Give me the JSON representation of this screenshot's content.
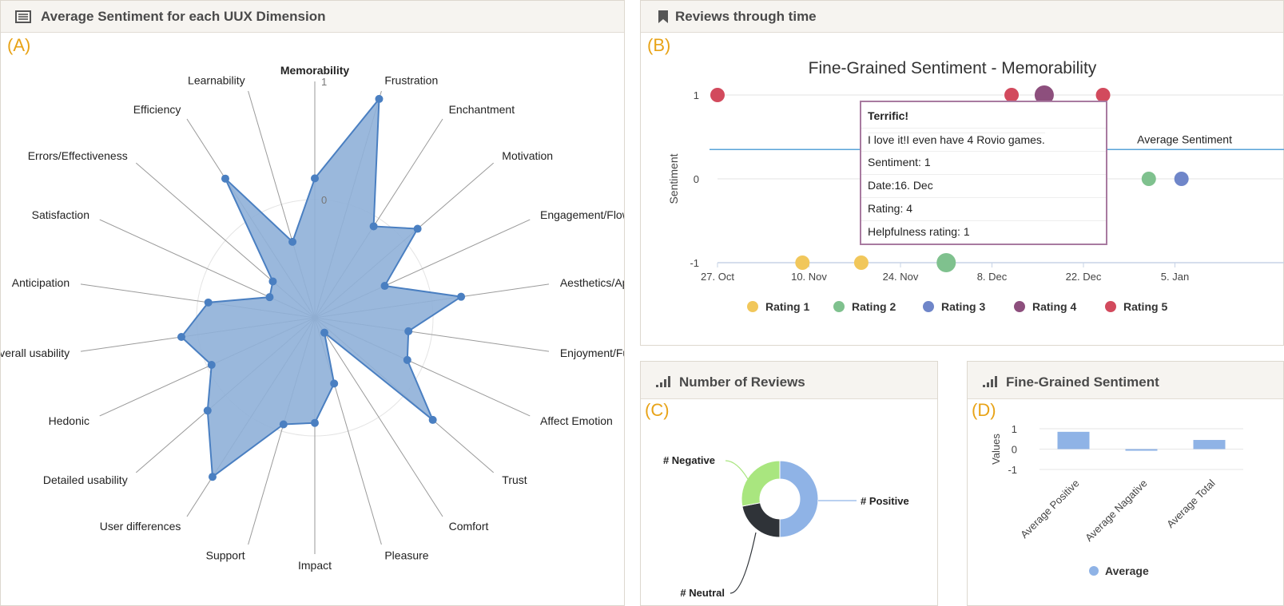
{
  "colors": {
    "accent_label": "#e8a317",
    "radar_fill": "#8fb0d8",
    "radar_line": "#4a7fc1",
    "rating1": "#f1c75b",
    "rating2": "#7fc18e",
    "rating3": "#6f86c9",
    "rating4": "#8d4f7d",
    "rating5": "#d24a5d",
    "positive": "#8fb3e6",
    "negative": "#a9e67f",
    "neutral": "#2f3338"
  },
  "panels": {
    "a": {
      "title": "Average Sentiment for each UUX Dimension",
      "label": "(A)",
      "icon": "list-icon"
    },
    "b": {
      "title": "Reviews through time",
      "label": "(B)",
      "icon": "bookmark-icon"
    },
    "c": {
      "title": "Number of Reviews",
      "label": "(C)",
      "icon": "signal-bars-icon"
    },
    "d": {
      "title": "Fine-Grained Sentiment",
      "label": "(D)",
      "icon": "signal-bars-icon"
    }
  },
  "tooltip": {
    "title": "Terrific!",
    "review": "I love it!I even have 4 Rovio games.",
    "sentiment": "Sentiment: 1",
    "date": "Date:16. Dec",
    "rating": "Rating: 4",
    "helpfulness": "Helpfulness rating: 1"
  },
  "chart_data": [
    {
      "type": "radar",
      "panel": "A",
      "categories": [
        "Memorability",
        "Frustration",
        "Enchantment",
        "Motivation",
        "Engagement/Flow",
        "Aesthetics/Appeal",
        "Enjoyment/Fun",
        "Affect Emotion",
        "Trust",
        "Comfort",
        "Pleasure",
        "Impact",
        "Support",
        "User differences",
        "Detailed usability",
        "Hedonic",
        "Overall usability",
        "Anticipation",
        "Satisfaction",
        "Errors/Effectiveness",
        "Efficiency",
        "Learnability"
      ],
      "values": [
        0.18,
        0.93,
        -0.08,
        0.15,
        -0.35,
        0.25,
        -0.2,
        -0.14,
        0.32,
        -0.85,
        -0.42,
        -0.11,
        -0.06,
        0.6,
        0.2,
        -0.04,
        0.14,
        -0.09,
        -0.58,
        -0.53,
        0.4,
        -0.33
      ],
      "value_label_memorability": "Memorability",
      "tick_labels": [
        "1",
        "0"
      ],
      "rlim": [
        -1,
        1
      ]
    },
    {
      "type": "scatter",
      "panel": "B",
      "title": "Fine-Grained Sentiment - Memorability",
      "ylabel": "Sentiment",
      "x_ticks": [
        "27. Oct",
        "10. Nov",
        "24. Nov",
        "8. Dec",
        "22. Dec",
        "5. Jan"
      ],
      "y_ticks": [
        "1",
        "0",
        "-1"
      ],
      "ylim": [
        -1,
        1
      ],
      "average_label": "Average Sentiment",
      "average_value": 0.35,
      "series": [
        {
          "name": "Rating 1",
          "color": "#f1c75b",
          "points": [
            [
              "2013-11-09",
              -1,
              8
            ],
            [
              "2013-11-18",
              -1,
              8
            ]
          ]
        },
        {
          "name": "Rating 2",
          "color": "#7fc18e",
          "points": [
            [
              "2013-12-01",
              -1,
              11
            ],
            [
              "2014-01-01",
              0,
              8
            ]
          ]
        },
        {
          "name": "Rating 3",
          "color": "#6f86c9",
          "points": [
            [
              "2014-01-06",
              0,
              8
            ]
          ]
        },
        {
          "name": "Rating 4",
          "color": "#8d4f7d",
          "points": [
            [
              "2013-12-16",
              1,
              11
            ]
          ]
        },
        {
          "name": "Rating 5",
          "color": "#d24a5d",
          "points": [
            [
              "2013-10-27",
              1,
              8
            ],
            [
              "2013-12-11",
              1,
              8
            ],
            [
              "2013-12-25",
              1,
              8
            ]
          ]
        }
      ]
    },
    {
      "type": "pie",
      "panel": "C",
      "labels": [
        "# Positive",
        "# Neutral",
        "# Negative"
      ],
      "values": [
        50,
        22,
        28
      ],
      "colors": [
        "#8fb3e6",
        "#2f3338",
        "#a9e67f"
      ]
    },
    {
      "type": "bar",
      "panel": "D",
      "categories": [
        "Average Positive",
        "Average Nagative",
        "Average Total"
      ],
      "values": [
        0.85,
        -0.08,
        0.45
      ],
      "ylabel": "Values",
      "y_ticks": [
        "1",
        "0",
        "-1"
      ],
      "ylim": [
        -1,
        1
      ],
      "legend": "Average"
    }
  ]
}
